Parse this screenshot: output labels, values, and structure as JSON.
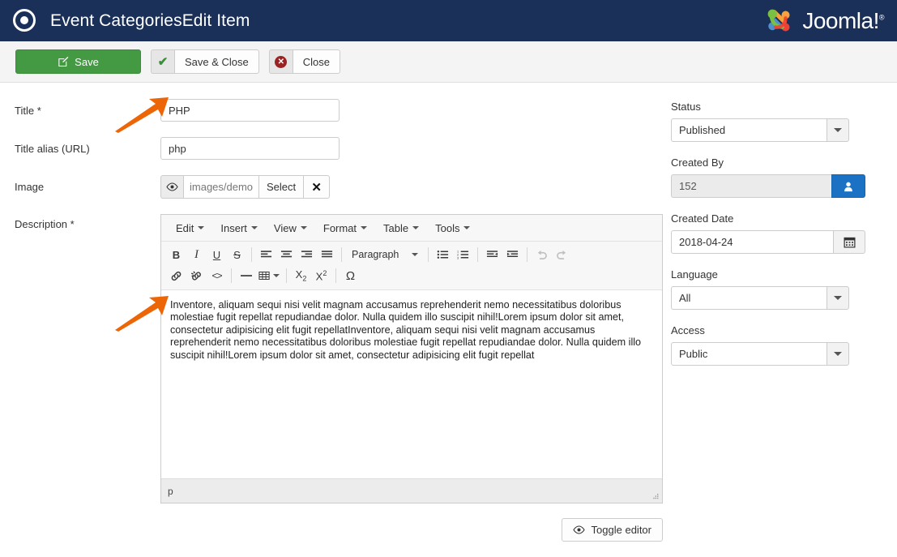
{
  "header": {
    "title": "Event CategoriesEdit Item",
    "brand_icon": "record-circle-icon",
    "logo_text": "Joomla!",
    "logo_sup": "®",
    "bg_color": "#1a3059"
  },
  "toolbar": {
    "save_label": "Save",
    "save_icon": "edit-square-icon",
    "save_color": "#439a43",
    "save_close_label": "Save & Close",
    "save_close_icon": "check-icon",
    "close_label": "Close",
    "close_icon": "x-circle-icon"
  },
  "form": {
    "title_label": "Title *",
    "title_value": "PHP",
    "alias_label": "Title alias (URL)",
    "alias_value": "php",
    "image_label": "Image",
    "image_value": "images/demo/e",
    "image_eye_icon": "eye-icon",
    "image_select_label": "Select",
    "image_clear_icon": "close-x-icon",
    "description_label": "Description *"
  },
  "editor": {
    "menus": [
      "Edit",
      "Insert",
      "View",
      "Format",
      "Table",
      "Tools"
    ],
    "toolbar_row1": [
      {
        "name": "bold-icon",
        "glyph": "B"
      },
      {
        "name": "italic-icon",
        "glyph": "I"
      },
      {
        "name": "underline-icon",
        "glyph": "U"
      },
      {
        "name": "strikethrough-icon",
        "glyph": "S"
      },
      {
        "name": "align-left-icon",
        "glyph": ""
      },
      {
        "name": "align-center-icon",
        "glyph": ""
      },
      {
        "name": "align-right-icon",
        "glyph": ""
      },
      {
        "name": "align-justify-icon",
        "glyph": ""
      }
    ],
    "format_select": "Paragraph",
    "toolbar_row1b": [
      {
        "name": "bullet-list-icon"
      },
      {
        "name": "numbered-list-icon"
      },
      {
        "name": "outdent-icon"
      },
      {
        "name": "indent-icon"
      },
      {
        "name": "undo-icon"
      },
      {
        "name": "redo-icon"
      }
    ],
    "toolbar_row2": [
      {
        "name": "link-icon"
      },
      {
        "name": "unlink-icon"
      },
      {
        "name": "source-code-icon",
        "glyph": "<>"
      },
      {
        "name": "horizontal-rule-icon"
      },
      {
        "name": "table-icon"
      },
      {
        "name": "subscript-icon",
        "glyph": "X₂"
      },
      {
        "name": "superscript-icon",
        "glyph": "X²"
      },
      {
        "name": "special-character-icon",
        "glyph": "Ω"
      }
    ],
    "body_text": "Inventore, aliquam sequi nisi velit magnam accusamus reprehenderit nemo necessitatibus doloribus molestiae fugit repellat repudiandae dolor. Nulla quidem illo suscipit nihil!Lorem ipsum dolor sit amet, consectetur adipisicing elit fugit repellatInventore, aliquam sequi nisi velit magnam accusamus reprehenderit nemo necessitatibus doloribus molestiae fugit repellat repudiandae dolor. Nulla quidem illo suscipit nihil!Lorem ipsum dolor sit amet, consectetur adipisicing elit fugit repellat",
    "status_path": "p",
    "toggle_label": "Toggle editor",
    "toggle_icon": "eye-icon"
  },
  "sidebar": {
    "status": {
      "label": "Status",
      "value": "Published"
    },
    "created_by": {
      "label": "Created By",
      "value": "152",
      "button_icon": "user-icon",
      "button_color": "#1b72c4"
    },
    "created_date": {
      "label": "Created Date",
      "value": "2018-04-24",
      "button_icon": "calendar-icon"
    },
    "language": {
      "label": "Language",
      "value": "All"
    },
    "access": {
      "label": "Access",
      "value": "Public"
    }
  },
  "annotations": {
    "arrow_color": "#ec6608",
    "arrow_1_target": "title-input",
    "arrow_2_target": "editor-body"
  }
}
